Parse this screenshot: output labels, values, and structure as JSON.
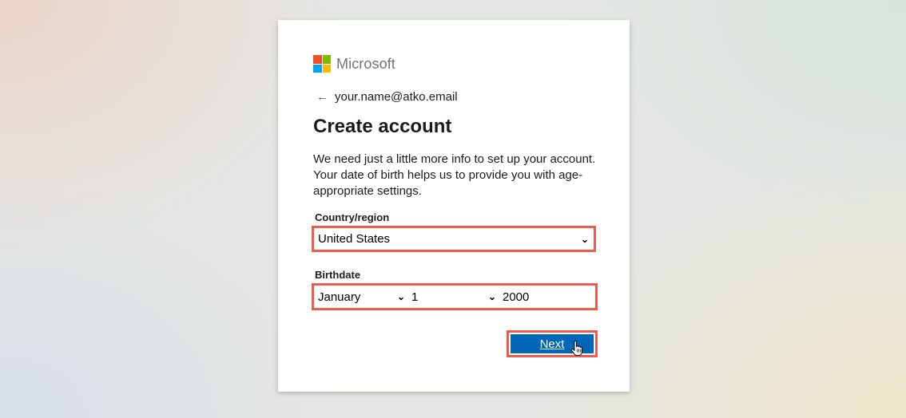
{
  "brand": {
    "name": "Microsoft",
    "logo_colors": [
      "#f25022",
      "#7fba00",
      "#00a4ef",
      "#ffb900"
    ]
  },
  "identity": {
    "back_icon": "back-arrow-icon",
    "email": "your.name@atko.email"
  },
  "page": {
    "title": "Create account",
    "description": "We need just a little more info to set up your account. Your date of birth helps us to provide you with age-appropriate settings."
  },
  "country": {
    "label": "Country/region",
    "selected": "United States"
  },
  "birthdate": {
    "label": "Birthdate",
    "month": "January",
    "day": "1",
    "year": "2000"
  },
  "actions": {
    "next_label": "Next"
  },
  "colors": {
    "accent": "#0067b8",
    "highlight": "#ee5a4f"
  }
}
